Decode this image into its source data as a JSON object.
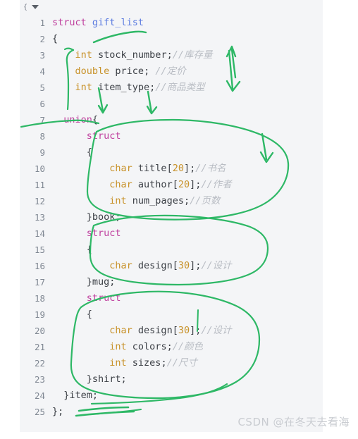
{
  "editor": {
    "fold_marker": "{",
    "fold_caret_icon": "chevron-down-icon",
    "background_color": "#f4f5f7",
    "gutter_color": "#808893",
    "line_count": 25,
    "lines": [
      {
        "number": "1",
        "tokens": [
          {
            "t": "struct ",
            "c": "kw"
          },
          {
            "t": "gift_list",
            "c": "typename"
          }
        ]
      },
      {
        "number": "2",
        "tokens": [
          {
            "t": "{",
            "c": "punc"
          }
        ]
      },
      {
        "number": "3",
        "tokens": [
          {
            "t": "    ",
            "c": "punc"
          },
          {
            "t": "int",
            "c": "type"
          },
          {
            "t": " stock_number;",
            "c": "ident"
          },
          {
            "t": "//库存量",
            "c": "cmt"
          }
        ]
      },
      {
        "number": "4",
        "tokens": [
          {
            "t": "    ",
            "c": "punc"
          },
          {
            "t": "double",
            "c": "type"
          },
          {
            "t": " price; ",
            "c": "ident"
          },
          {
            "t": "//定价",
            "c": "cmt"
          }
        ]
      },
      {
        "number": "5",
        "tokens": [
          {
            "t": "    ",
            "c": "punc"
          },
          {
            "t": "int",
            "c": "type"
          },
          {
            "t": " item_type;",
            "c": "ident"
          },
          {
            "t": "//商品类型",
            "c": "cmt"
          }
        ]
      },
      {
        "number": "6",
        "tokens": []
      },
      {
        "number": "7",
        "tokens": [
          {
            "t": "  ",
            "c": "punc"
          },
          {
            "t": "union",
            "c": "kw"
          },
          {
            "t": "{",
            "c": "punc"
          }
        ]
      },
      {
        "number": "8",
        "tokens": [
          {
            "t": "      ",
            "c": "punc"
          },
          {
            "t": "struct",
            "c": "kw"
          }
        ]
      },
      {
        "number": "9",
        "tokens": [
          {
            "t": "      {",
            "c": "punc"
          }
        ]
      },
      {
        "number": "10",
        "tokens": [
          {
            "t": "          ",
            "c": "punc"
          },
          {
            "t": "char",
            "c": "type"
          },
          {
            "t": " title[",
            "c": "ident"
          },
          {
            "t": "20",
            "c": "num"
          },
          {
            "t": "];",
            "c": "ident"
          },
          {
            "t": "//书名",
            "c": "cmt"
          }
        ]
      },
      {
        "number": "11",
        "tokens": [
          {
            "t": "          ",
            "c": "punc"
          },
          {
            "t": "char",
            "c": "type"
          },
          {
            "t": " author[",
            "c": "ident"
          },
          {
            "t": "20",
            "c": "num"
          },
          {
            "t": "];",
            "c": "ident"
          },
          {
            "t": "//作者",
            "c": "cmt"
          }
        ]
      },
      {
        "number": "12",
        "tokens": [
          {
            "t": "          ",
            "c": "punc"
          },
          {
            "t": "int",
            "c": "type"
          },
          {
            "t": " num_pages;",
            "c": "ident"
          },
          {
            "t": "//页数",
            "c": "cmt"
          }
        ]
      },
      {
        "number": "13",
        "tokens": [
          {
            "t": "      }book;",
            "c": "ident"
          }
        ]
      },
      {
        "number": "14",
        "tokens": [
          {
            "t": "      ",
            "c": "punc"
          },
          {
            "t": "struct",
            "c": "kw"
          }
        ]
      },
      {
        "number": "15",
        "tokens": [
          {
            "t": "      {",
            "c": "punc"
          }
        ]
      },
      {
        "number": "16",
        "tokens": [
          {
            "t": "          ",
            "c": "punc"
          },
          {
            "t": "char",
            "c": "type"
          },
          {
            "t": " design[",
            "c": "ident"
          },
          {
            "t": "30",
            "c": "num"
          },
          {
            "t": "];",
            "c": "ident"
          },
          {
            "t": "//设计",
            "c": "cmt"
          }
        ]
      },
      {
        "number": "17",
        "tokens": [
          {
            "t": "      }mug;",
            "c": "ident"
          }
        ]
      },
      {
        "number": "18",
        "tokens": [
          {
            "t": "      ",
            "c": "punc"
          },
          {
            "t": "struct",
            "c": "kw"
          }
        ]
      },
      {
        "number": "19",
        "tokens": [
          {
            "t": "      {",
            "c": "punc"
          }
        ]
      },
      {
        "number": "20",
        "tokens": [
          {
            "t": "          ",
            "c": "punc"
          },
          {
            "t": "char",
            "c": "type"
          },
          {
            "t": " design[",
            "c": "ident"
          },
          {
            "t": "30",
            "c": "num"
          },
          {
            "t": "];",
            "c": "ident"
          },
          {
            "t": "//设计",
            "c": "cmt"
          }
        ]
      },
      {
        "number": "21",
        "tokens": [
          {
            "t": "          ",
            "c": "punc"
          },
          {
            "t": "int",
            "c": "type"
          },
          {
            "t": " colors;",
            "c": "ident"
          },
          {
            "t": "//颜色",
            "c": "cmt"
          }
        ]
      },
      {
        "number": "22",
        "tokens": [
          {
            "t": "          ",
            "c": "punc"
          },
          {
            "t": "int",
            "c": "type"
          },
          {
            "t": " sizes;",
            "c": "ident"
          },
          {
            "t": "//尺寸",
            "c": "cmt"
          }
        ]
      },
      {
        "number": "23",
        "tokens": [
          {
            "t": "      }shirt;",
            "c": "ident"
          }
        ]
      },
      {
        "number": "24",
        "tokens": [
          {
            "t": "  }item;",
            "c": "ident"
          }
        ]
      },
      {
        "number": "25",
        "tokens": [
          {
            "t": "};",
            "c": "punc"
          }
        ]
      }
    ]
  },
  "annotations": {
    "ink_color": "#2eb866",
    "description": "hand-drawn green pen marks: arrows, brace strokes, circled regions and underlines"
  },
  "watermark": {
    "text": "CSDN @在冬天去看海",
    "color": "#c9ccd1"
  }
}
